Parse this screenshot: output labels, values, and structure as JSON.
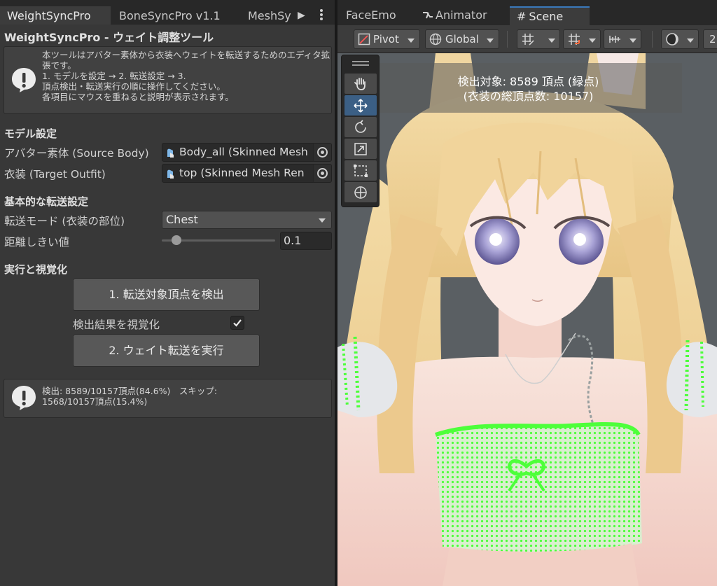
{
  "left_tabs": [
    "WeightSyncPro",
    "BoneSyncPro v1.1",
    "MeshSy"
  ],
  "window_title": "WeightSyncPro - ウェイト調整ツール",
  "intro_help": {
    "line1": "本ツールはアバター素体から衣装へウェイトを転送するためのエディタ拡",
    "line2": "張です。",
    "line3": "1. モデルを設定 → 2. 転送設定 → 3.",
    "line4": "頂点検出・転送実行の順に操作してください。",
    "line5": "各項目にマウスを重ねると説明が表示されます。"
  },
  "model_section": {
    "title": "モデル設定",
    "source_label": "アバター素体 (Source Body)",
    "source_value": "Body_all (Skinned Mesh",
    "target_label": "衣装 (Target Outfit)",
    "target_value": "top (Skinned Mesh Ren"
  },
  "transfer_section": {
    "title": "基本的な転送設定",
    "mode_label": "転送モード (衣装の部位)",
    "mode_value": "Chest",
    "threshold_label": "距離しきい値",
    "threshold_value": "0.1",
    "threshold_level": 0.1
  },
  "run_section": {
    "title": "実行と視覚化",
    "detect_button": "1. 転送対象頂点を検出",
    "visualize_label": "検出結果を視覚化",
    "visualize_checked": true,
    "transfer_button": "2. ウェイト転送を実行"
  },
  "result_help": {
    "line1": "検出: 8589/10157頂点(84.6%)　スキップ:",
    "line2": "1568/10157頂点(15.4%)"
  },
  "right_tabs": [
    "FaceEmo",
    "Animator",
    "Scene"
  ],
  "scene_toolbar": {
    "pivot_label": "Pivot",
    "global_label": "Global",
    "more_label": "2"
  },
  "scene_overlay": {
    "line1": "検出対象: 8589 頂点 (緑点)",
    "line2": "(衣装の総頂点数: 10157)"
  },
  "colors": {
    "accent": "#3a79bb",
    "detected_vertex": "#4dff3a",
    "hair": "#f2d49a"
  }
}
